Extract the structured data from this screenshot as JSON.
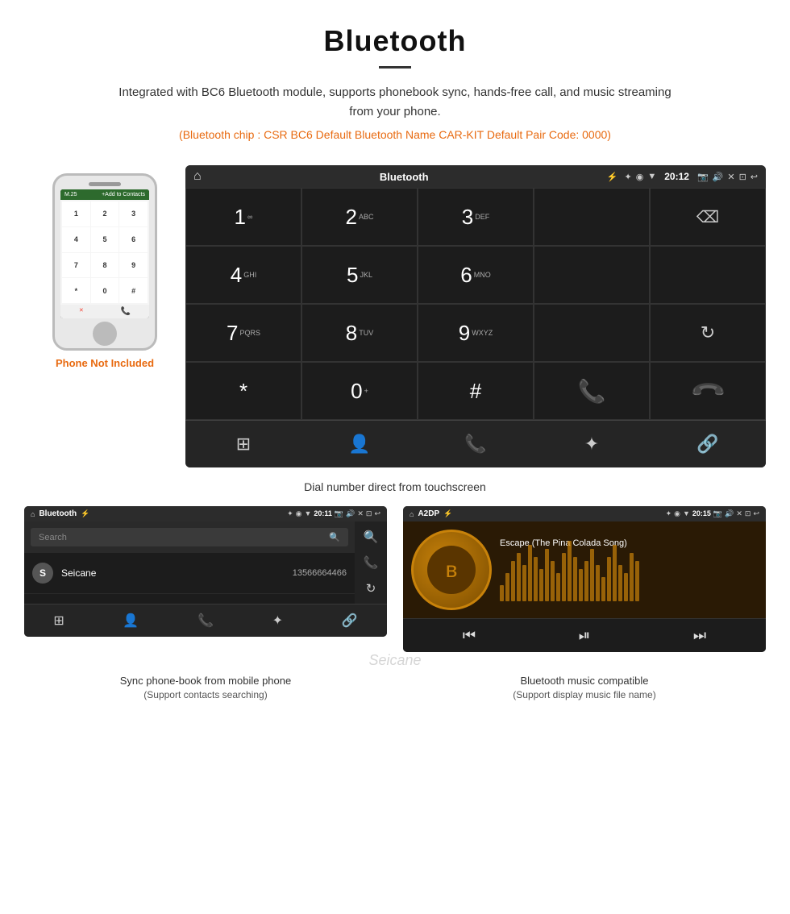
{
  "header": {
    "title": "Bluetooth",
    "description": "Integrated with BC6 Bluetooth module, supports phonebook sync, hands-free call, and music streaming from your phone.",
    "specs": "(Bluetooth chip : CSR BC6    Default Bluetooth Name CAR-KIT    Default Pair Code: 0000)"
  },
  "phone_label": "Phone Not Included",
  "dialpad_screen": {
    "status_bar": {
      "home": "⌂",
      "title": "Bluetooth",
      "usb": "⚡",
      "bluetooth": "✦",
      "location": "◉",
      "wifi": "▼",
      "time": "20:12",
      "camera": "📷",
      "volume": "🔊",
      "x": "✕",
      "screen": "⊡",
      "back": "↩"
    },
    "keys": [
      {
        "number": "1",
        "letters": "∞"
      },
      {
        "number": "2",
        "letters": "ABC"
      },
      {
        "number": "3",
        "letters": "DEF"
      },
      {
        "number": "",
        "letters": ""
      },
      {
        "number": "⌫",
        "letters": ""
      },
      {
        "number": "4",
        "letters": "GHI"
      },
      {
        "number": "5",
        "letters": "JKL"
      },
      {
        "number": "6",
        "letters": "MNO"
      },
      {
        "number": "",
        "letters": ""
      },
      {
        "number": "",
        "letters": ""
      },
      {
        "number": "7",
        "letters": "PQRS"
      },
      {
        "number": "8",
        "letters": "TUV"
      },
      {
        "number": "9",
        "letters": "WXYZ"
      },
      {
        "number": "",
        "letters": ""
      },
      {
        "number": "↻",
        "letters": ""
      },
      {
        "number": "*",
        "letters": ""
      },
      {
        "number": "0",
        "letters": "+"
      },
      {
        "number": "#",
        "letters": ""
      },
      {
        "number": "📞",
        "letters": ""
      },
      {
        "number": "📵",
        "letters": ""
      }
    ],
    "bottom_icons": [
      "⊞",
      "👤",
      "📞",
      "✦",
      "🔗"
    ]
  },
  "caption_dialpad": "Dial number direct from touchscreen",
  "phonebook_screen": {
    "status_bar": {
      "title": "Bluetooth",
      "time": "20:11"
    },
    "search_placeholder": "Search",
    "contacts": [
      {
        "letter": "S",
        "name": "Seicane",
        "number": "13566664466"
      }
    ],
    "bottom_icons": [
      "⊞",
      "👤",
      "📞",
      "✦",
      "🔗"
    ]
  },
  "a2dp_screen": {
    "status_bar": {
      "title": "A2DP",
      "time": "20:15"
    },
    "song_title": "Escape (The Pina Colada Song)",
    "controls": [
      "⏮",
      "⏯",
      "⏭"
    ],
    "eq_bars": [
      20,
      35,
      50,
      60,
      45,
      70,
      55,
      40,
      65,
      50,
      35,
      60,
      75,
      55,
      40,
      50,
      65,
      45,
      30,
      55,
      70,
      45,
      35,
      60,
      50
    ]
  },
  "caption_phonebook": {
    "main": "Sync phone-book from mobile phone",
    "sub": "(Support contacts searching)"
  },
  "caption_a2dp": {
    "main": "Bluetooth music compatible",
    "sub": "(Support display music file name)"
  },
  "watermark": "Seicane"
}
